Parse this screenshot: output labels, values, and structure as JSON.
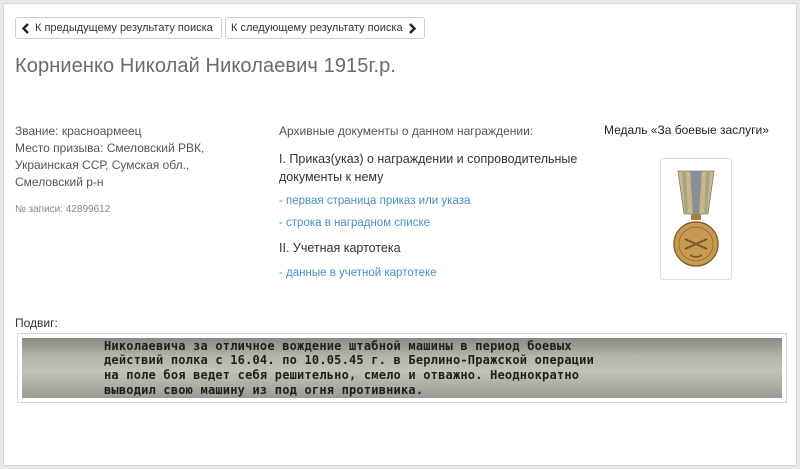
{
  "nav": {
    "prev_label": "К предыдущему результату поиска",
    "next_label": "К следующему результату поиска"
  },
  "person": {
    "name": "Корниенко Николай Николаевич 1915г.р.",
    "rank": "Звание: красноармеец",
    "draft_place_line1": "Место призыва: Смеловский РВК,",
    "draft_place_line2": "Украинская ССР, Сумская обл.,",
    "draft_place_line3": "Смеловский р-н",
    "record_no": "№ записи: 42899612"
  },
  "documents": {
    "heading": "Архивные документы о данном награждении:",
    "section1_title": "I. Приказ(указ) о награждении и сопроводительные документы к нему",
    "link_first_page": "- первая страница приказ или указа",
    "link_award_list": "- строка в наградном списке",
    "section2_title": "II. Учетная картотека",
    "link_card_data": "- данные в учетной картотеке"
  },
  "medal": {
    "caption": "Медаль «За боевые заслуги»",
    "ribbon_color": "#c9b98a",
    "ribbon_stripe_color": "#8a8f96",
    "metal_color": "#c99a54"
  },
  "podvig": {
    "label": "Подвиг:",
    "scan_lines": [
      "Николаевича за отличное вождение штабной машины в период боевых",
      "действий полка с 16.04. по 10.05.45 г. в Берлино-Пражской операции",
      "на поле боя ведет себя решительно, смело и отважно. Неоднократно",
      "выводил свою машину из под огня противника."
    ]
  },
  "icons": {
    "prev": "chevron-left-icon",
    "next": "chevron-right-icon"
  }
}
